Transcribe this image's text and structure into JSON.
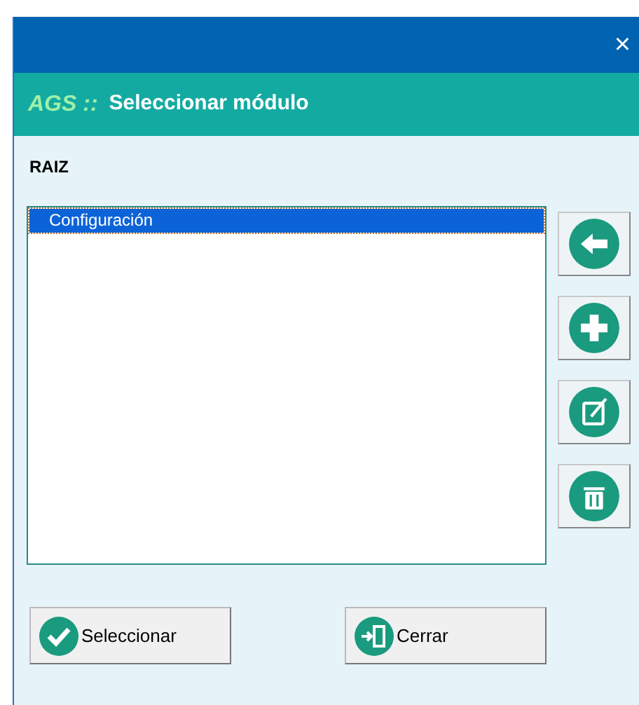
{
  "window": {
    "close": "×"
  },
  "header": {
    "brand": "AGS ::",
    "title": "Seleccionar módulo"
  },
  "path": "RAIZ",
  "list": {
    "items": [
      {
        "label": "Configuración",
        "selected": true
      }
    ]
  },
  "side_buttons": [
    {
      "kind": "back"
    },
    {
      "kind": "add"
    },
    {
      "kind": "edit"
    },
    {
      "kind": "delete"
    }
  ],
  "buttons": [
    {
      "kind": "select",
      "label": "Seleccionar"
    },
    {
      "kind": "close",
      "label": "Cerrar"
    }
  ]
}
